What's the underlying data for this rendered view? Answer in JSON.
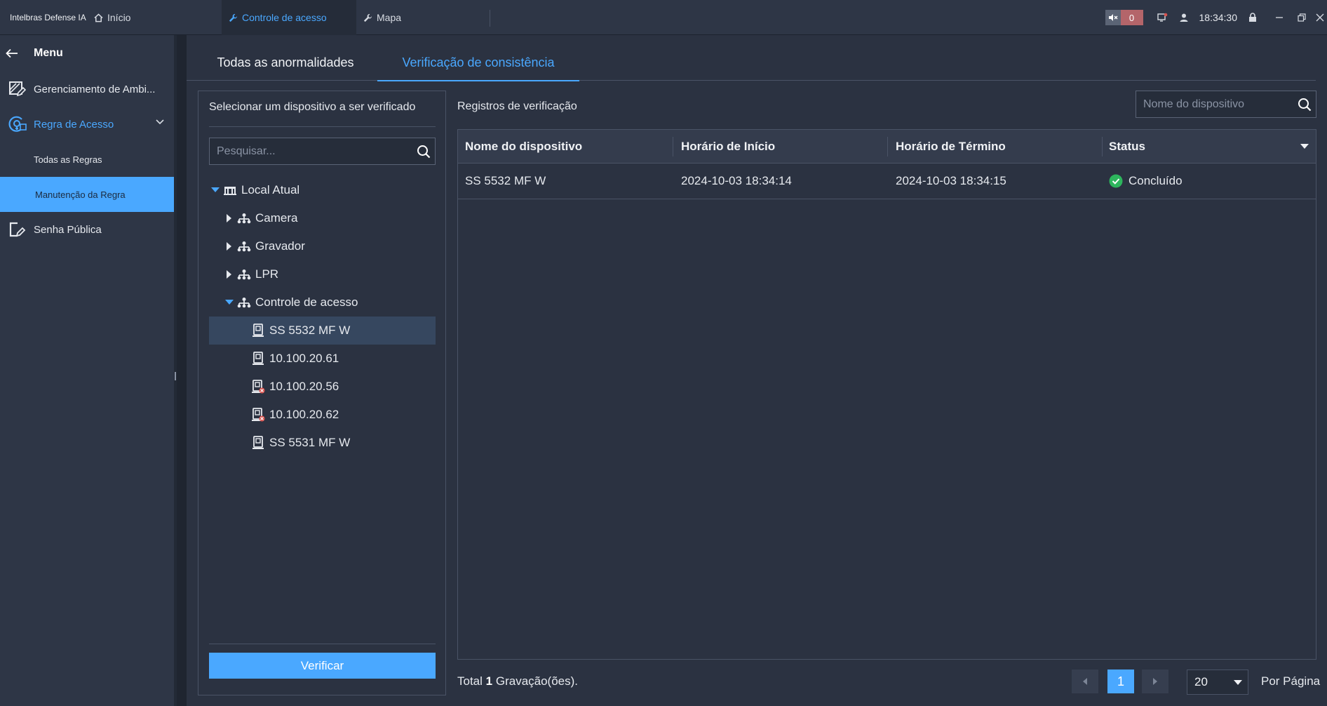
{
  "app": {
    "title": "Intelbras Defense IA",
    "tabs": [
      {
        "label": "Início",
        "icon": "home-icon"
      },
      {
        "label": "Controle de acesso",
        "icon": "wrench-icon",
        "active": true
      },
      {
        "label": "Mapa",
        "icon": "wrench-icon"
      }
    ],
    "alarm_count": "0",
    "clock": "18:34:30"
  },
  "sidebar": {
    "menu_label": "Menu",
    "items": [
      {
        "label": "Gerenciamento de Ambi...",
        "icon": "environment-edit-icon"
      },
      {
        "label": "Regra de Acesso",
        "icon": "access-rule-icon",
        "expanded": true
      },
      {
        "label": "Senha Pública",
        "icon": "public-password-icon"
      }
    ],
    "subitems": [
      {
        "label": "Todas as Regras"
      },
      {
        "label": "Manutenção da Regra",
        "active": true
      }
    ]
  },
  "main": {
    "tabs": [
      {
        "label": "Todas as anormalidades"
      },
      {
        "label": "Verificação de consistência",
        "active": true
      }
    ]
  },
  "device_panel": {
    "title": "Selecionar um dispositivo a ser verificado",
    "search_placeholder": "Pesquisar...",
    "tree": {
      "root": "Local Atual",
      "groups": [
        "Camera",
        "Gravador",
        "LPR",
        "Controle de acesso"
      ],
      "devices": [
        {
          "label": "SS 5532 MF W",
          "selected": true,
          "offline": false
        },
        {
          "label": "10.100.20.61",
          "offline": false
        },
        {
          "label": "10.100.20.56",
          "offline": true
        },
        {
          "label": "10.100.20.62",
          "offline": true
        },
        {
          "label": "SS 5531 MF W",
          "offline": false
        }
      ]
    },
    "verify_label": "Verificar"
  },
  "records": {
    "title": "Registros de verificação",
    "search_placeholder": "Nome do dispositivo",
    "columns": [
      "Nome do dispositivo",
      "Horário de Início",
      "Horário de Término",
      "Status"
    ],
    "rows": [
      {
        "device": "SS 5532 MF W",
        "start": "2024-10-03 18:34:14",
        "end": "2024-10-03 18:34:15",
        "status": "Concluído"
      }
    ]
  },
  "pagination": {
    "total_prefix": "Total",
    "total_count": "1",
    "total_suffix": "Gravação(ões).",
    "current_page": "1",
    "per_page": "20",
    "per_page_label": "Por Página"
  },
  "colors": {
    "accent": "#4aa8ff",
    "success": "#2db55d",
    "alarm": "#b4656a"
  }
}
